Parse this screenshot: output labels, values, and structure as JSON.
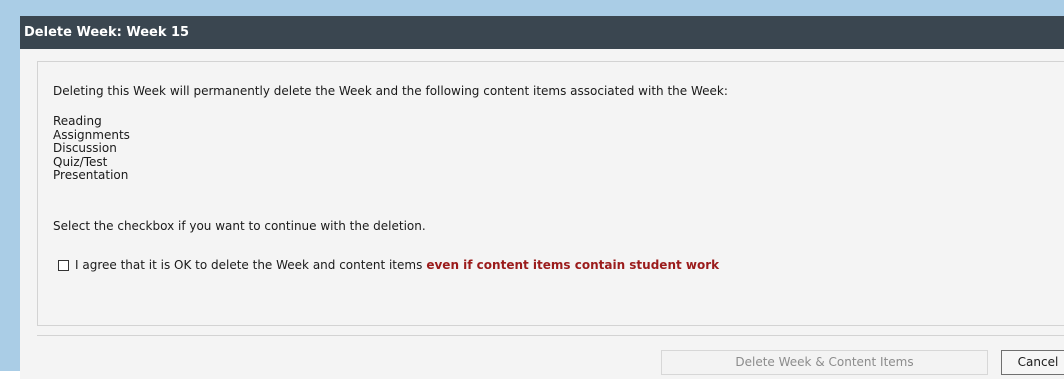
{
  "dialog": {
    "title": "Delete Week: Week 15",
    "intro": "Deleting this Week will permanently delete the Week and the following content items associated with the Week:",
    "items": [
      "Reading",
      "Assignments",
      "Discussion",
      "Quiz/Test",
      "Presentation"
    ],
    "select_hint": "Select the checkbox if you want to continue with the deletion.",
    "agree_text": "I agree that it is OK to delete the Week and content items",
    "agree_warning": "even if content items contain student work",
    "checkbox_checked": false
  },
  "buttons": {
    "delete_label": "Delete Week & Content Items",
    "delete_enabled": false,
    "cancel_label": "Cancel"
  },
  "colors": {
    "titlebar": "#3a4650",
    "frame": "#aacde6",
    "warning": "#9b1b1b"
  }
}
